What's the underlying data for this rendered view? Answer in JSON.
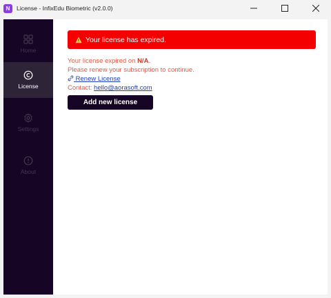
{
  "window": {
    "title": "License - InfixEdu Biometric (v2.0.0)",
    "app_icon_letter": "N"
  },
  "sidebar": {
    "items": [
      {
        "label": "Home",
        "icon": "grid-icon",
        "active": false
      },
      {
        "label": "License",
        "icon": "copyright-icon",
        "active": true
      },
      {
        "label": "Settings",
        "icon": "gear-icon",
        "active": false
      },
      {
        "label": "About",
        "icon": "info-icon",
        "active": false
      }
    ]
  },
  "license": {
    "alert_text": "Your license has expired.",
    "expired_prefix": "Your license expired on ",
    "expired_value": "N/A",
    "expired_suffix": ".",
    "renew_message": "Please renew your subscription to continue.",
    "renew_link": "Renew License",
    "contact_label": "Contact: ",
    "contact_email": "hello@aorasoft.com",
    "add_button": "Add new license"
  },
  "colors": {
    "sidebar_bg": "#170526",
    "alert_bg": "#f40000",
    "message_text": "#e05a4a",
    "link": "#1e3fbf"
  }
}
